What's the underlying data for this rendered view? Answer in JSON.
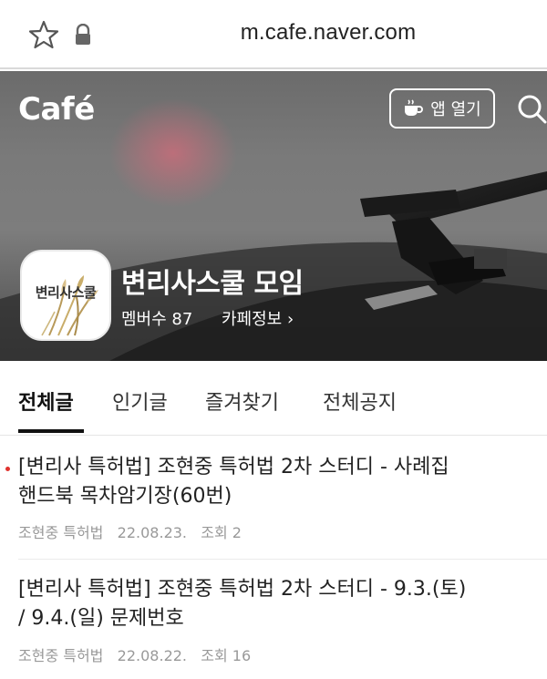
{
  "browser": {
    "url": "m.cafe.naver.com"
  },
  "header": {
    "brand": "Café",
    "app_button_label": "앱 열기"
  },
  "cafe": {
    "name": "변리사스쿨 모임",
    "logo_text": "변리사스쿨",
    "members": "멤버수 87",
    "info_link": "카페정보 ›"
  },
  "tabs": [
    {
      "label": "전체글",
      "active": true
    },
    {
      "label": "인기글",
      "active": false
    },
    {
      "label": "즐겨찾기",
      "active": false
    },
    {
      "label": "전체공지",
      "active": false
    }
  ],
  "posts": [
    {
      "title_line1": "[변리사 특허법] 조현중 특허법 2차 스터디 - 사례집",
      "title_line2": "핸드북 목차암기장(60번)",
      "author": "조현중 특허법",
      "date": "22.08.23.",
      "views": "조회 2",
      "new": true
    },
    {
      "title_line1": "[변리사 특허법] 조현중 특허법 2차 스터디 - 9.3.(토)",
      "title_line2": "/ 9.4.(일) 문제번호",
      "author": "조현중 특허법",
      "date": "22.08.22.",
      "views": "조회 16",
      "new": false
    }
  ],
  "colors": {
    "new_dot": "#e0322d",
    "meta_text": "#999999"
  }
}
